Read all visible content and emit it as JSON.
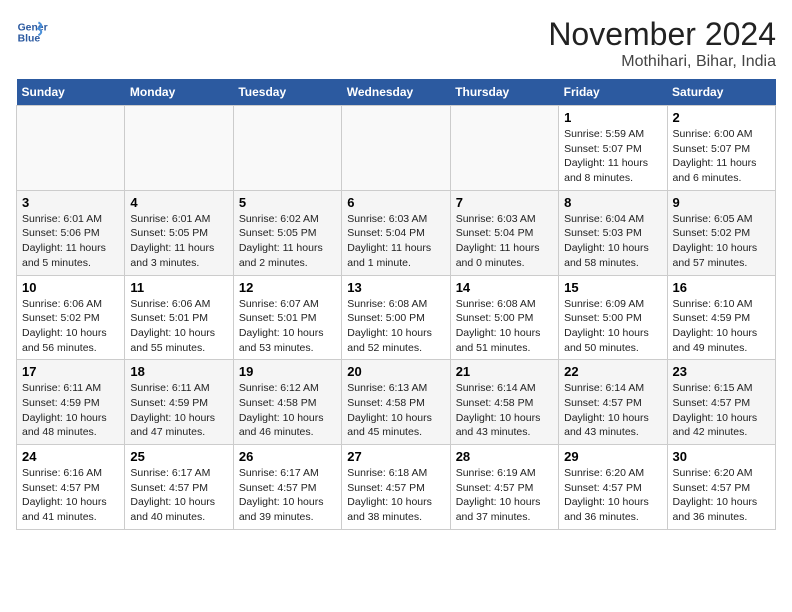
{
  "header": {
    "logo_line1": "General",
    "logo_line2": "Blue",
    "month": "November 2024",
    "location": "Mothihari, Bihar, India"
  },
  "weekdays": [
    "Sunday",
    "Monday",
    "Tuesday",
    "Wednesday",
    "Thursday",
    "Friday",
    "Saturday"
  ],
  "weeks": [
    [
      {
        "day": "",
        "info": ""
      },
      {
        "day": "",
        "info": ""
      },
      {
        "day": "",
        "info": ""
      },
      {
        "day": "",
        "info": ""
      },
      {
        "day": "",
        "info": ""
      },
      {
        "day": "1",
        "info": "Sunrise: 5:59 AM\nSunset: 5:07 PM\nDaylight: 11 hours\nand 8 minutes."
      },
      {
        "day": "2",
        "info": "Sunrise: 6:00 AM\nSunset: 5:07 PM\nDaylight: 11 hours\nand 6 minutes."
      }
    ],
    [
      {
        "day": "3",
        "info": "Sunrise: 6:01 AM\nSunset: 5:06 PM\nDaylight: 11 hours\nand 5 minutes."
      },
      {
        "day": "4",
        "info": "Sunrise: 6:01 AM\nSunset: 5:05 PM\nDaylight: 11 hours\nand 3 minutes."
      },
      {
        "day": "5",
        "info": "Sunrise: 6:02 AM\nSunset: 5:05 PM\nDaylight: 11 hours\nand 2 minutes."
      },
      {
        "day": "6",
        "info": "Sunrise: 6:03 AM\nSunset: 5:04 PM\nDaylight: 11 hours\nand 1 minute."
      },
      {
        "day": "7",
        "info": "Sunrise: 6:03 AM\nSunset: 5:04 PM\nDaylight: 11 hours\nand 0 minutes."
      },
      {
        "day": "8",
        "info": "Sunrise: 6:04 AM\nSunset: 5:03 PM\nDaylight: 10 hours\nand 58 minutes."
      },
      {
        "day": "9",
        "info": "Sunrise: 6:05 AM\nSunset: 5:02 PM\nDaylight: 10 hours\nand 57 minutes."
      }
    ],
    [
      {
        "day": "10",
        "info": "Sunrise: 6:06 AM\nSunset: 5:02 PM\nDaylight: 10 hours\nand 56 minutes."
      },
      {
        "day": "11",
        "info": "Sunrise: 6:06 AM\nSunset: 5:01 PM\nDaylight: 10 hours\nand 55 minutes."
      },
      {
        "day": "12",
        "info": "Sunrise: 6:07 AM\nSunset: 5:01 PM\nDaylight: 10 hours\nand 53 minutes."
      },
      {
        "day": "13",
        "info": "Sunrise: 6:08 AM\nSunset: 5:00 PM\nDaylight: 10 hours\nand 52 minutes."
      },
      {
        "day": "14",
        "info": "Sunrise: 6:08 AM\nSunset: 5:00 PM\nDaylight: 10 hours\nand 51 minutes."
      },
      {
        "day": "15",
        "info": "Sunrise: 6:09 AM\nSunset: 5:00 PM\nDaylight: 10 hours\nand 50 minutes."
      },
      {
        "day": "16",
        "info": "Sunrise: 6:10 AM\nSunset: 4:59 PM\nDaylight: 10 hours\nand 49 minutes."
      }
    ],
    [
      {
        "day": "17",
        "info": "Sunrise: 6:11 AM\nSunset: 4:59 PM\nDaylight: 10 hours\nand 48 minutes."
      },
      {
        "day": "18",
        "info": "Sunrise: 6:11 AM\nSunset: 4:59 PM\nDaylight: 10 hours\nand 47 minutes."
      },
      {
        "day": "19",
        "info": "Sunrise: 6:12 AM\nSunset: 4:58 PM\nDaylight: 10 hours\nand 46 minutes."
      },
      {
        "day": "20",
        "info": "Sunrise: 6:13 AM\nSunset: 4:58 PM\nDaylight: 10 hours\nand 45 minutes."
      },
      {
        "day": "21",
        "info": "Sunrise: 6:14 AM\nSunset: 4:58 PM\nDaylight: 10 hours\nand 43 minutes."
      },
      {
        "day": "22",
        "info": "Sunrise: 6:14 AM\nSunset: 4:57 PM\nDaylight: 10 hours\nand 43 minutes."
      },
      {
        "day": "23",
        "info": "Sunrise: 6:15 AM\nSunset: 4:57 PM\nDaylight: 10 hours\nand 42 minutes."
      }
    ],
    [
      {
        "day": "24",
        "info": "Sunrise: 6:16 AM\nSunset: 4:57 PM\nDaylight: 10 hours\nand 41 minutes."
      },
      {
        "day": "25",
        "info": "Sunrise: 6:17 AM\nSunset: 4:57 PM\nDaylight: 10 hours\nand 40 minutes."
      },
      {
        "day": "26",
        "info": "Sunrise: 6:17 AM\nSunset: 4:57 PM\nDaylight: 10 hours\nand 39 minutes."
      },
      {
        "day": "27",
        "info": "Sunrise: 6:18 AM\nSunset: 4:57 PM\nDaylight: 10 hours\nand 38 minutes."
      },
      {
        "day": "28",
        "info": "Sunrise: 6:19 AM\nSunset: 4:57 PM\nDaylight: 10 hours\nand 37 minutes."
      },
      {
        "day": "29",
        "info": "Sunrise: 6:20 AM\nSunset: 4:57 PM\nDaylight: 10 hours\nand 36 minutes."
      },
      {
        "day": "30",
        "info": "Sunrise: 6:20 AM\nSunset: 4:57 PM\nDaylight: 10 hours\nand 36 minutes."
      }
    ]
  ]
}
